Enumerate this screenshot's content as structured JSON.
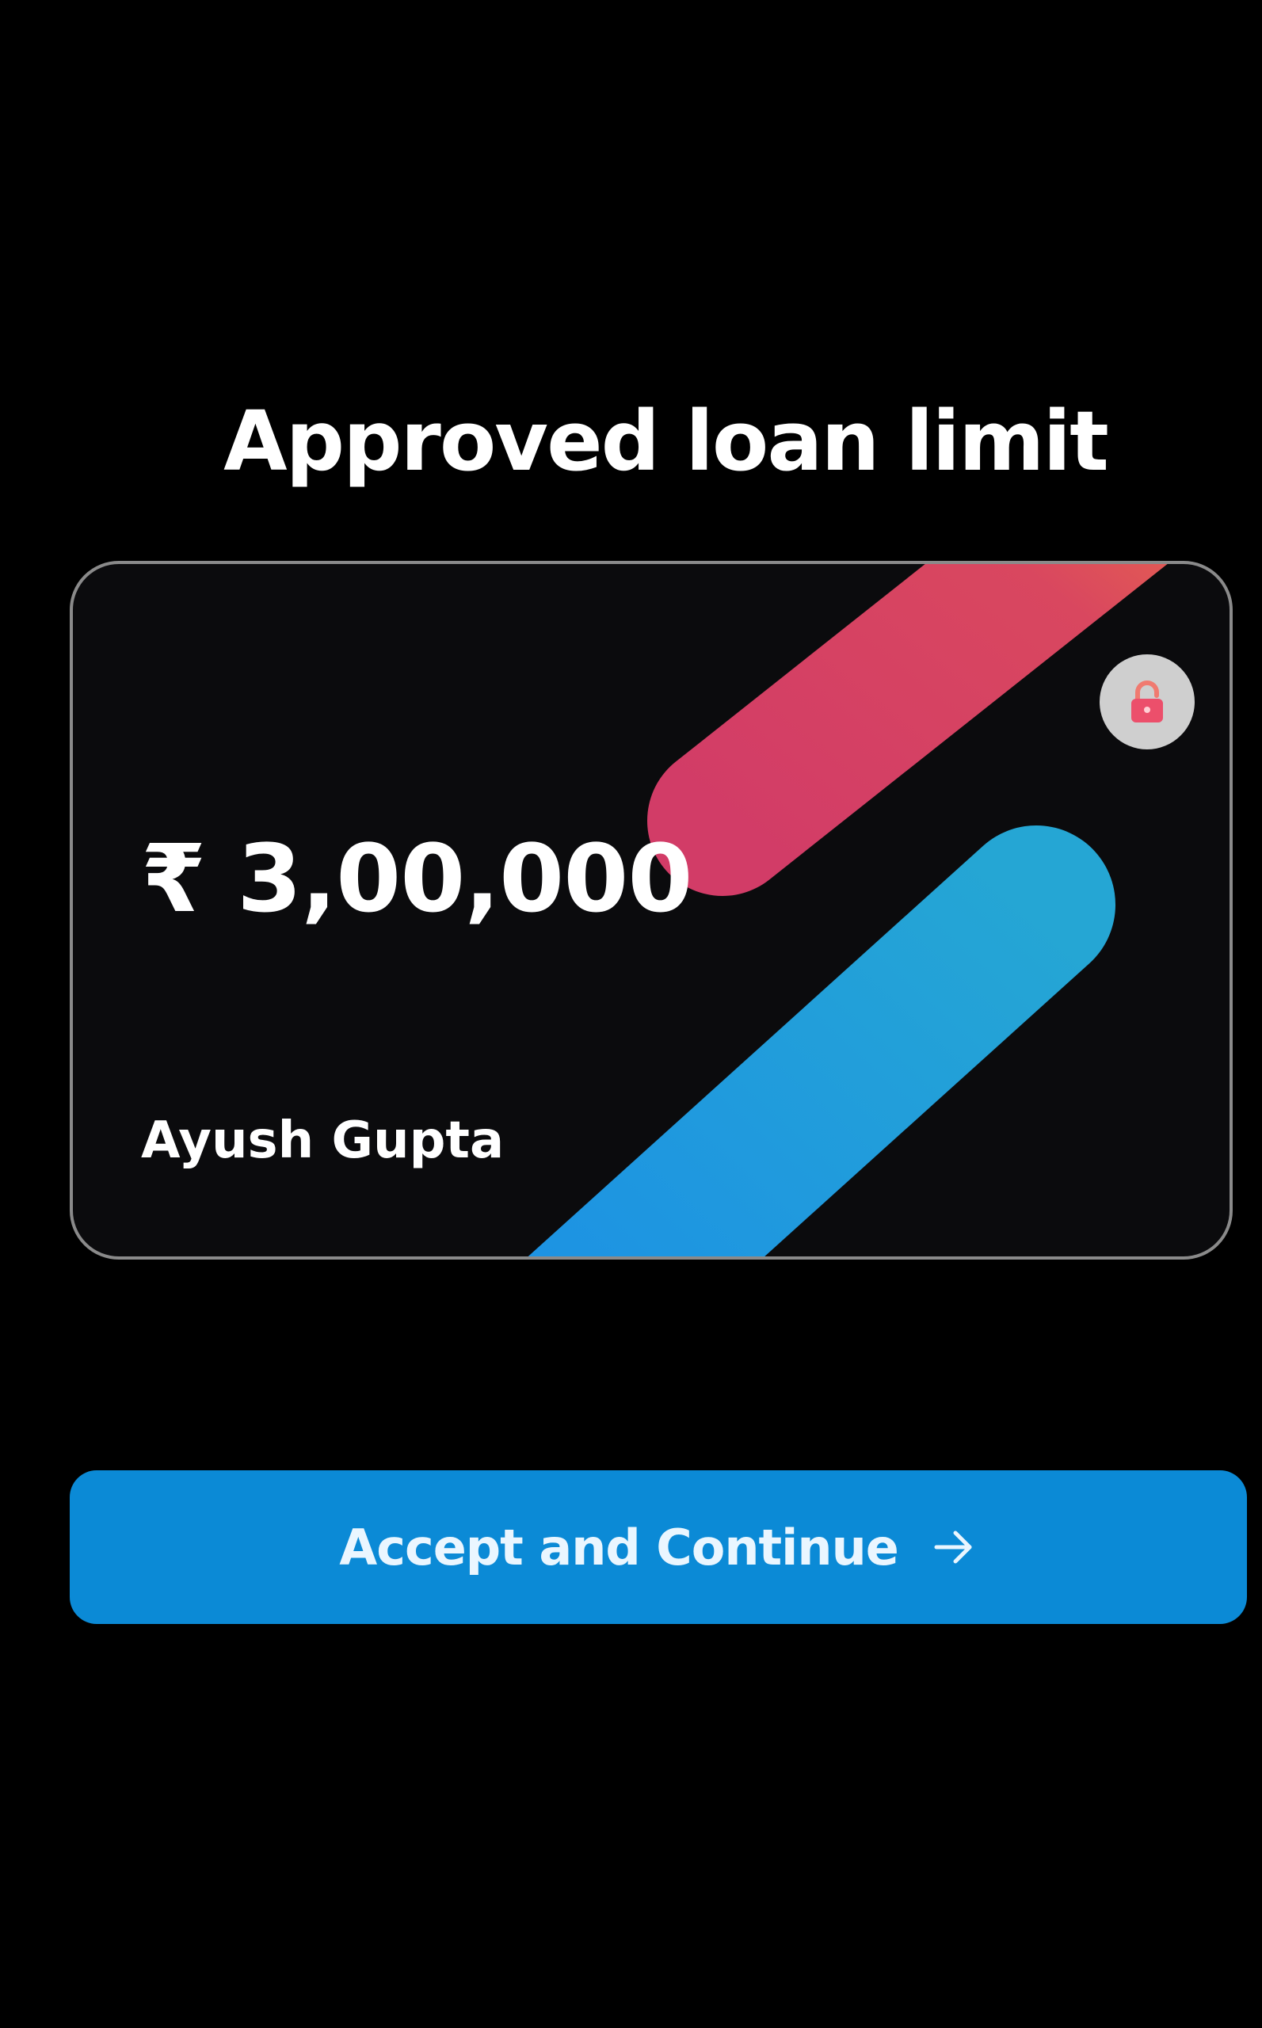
{
  "title": "Approved loan limit",
  "card": {
    "amount": "₹ 3,00,000",
    "holder_name": "Ayush Gupta",
    "lock_icon": "lock-icon",
    "stripe_colors": {
      "top": [
        "#d23c67",
        "#e8664d"
      ],
      "bottom": [
        "#1b8fe6",
        "#25a6d4"
      ]
    }
  },
  "actions": {
    "accept_label": "Accept and Continue",
    "accept_icon": "arrow-right-icon"
  },
  "colors": {
    "background": "#000000",
    "button": "#0b8ad6",
    "text": "#ffffff"
  }
}
